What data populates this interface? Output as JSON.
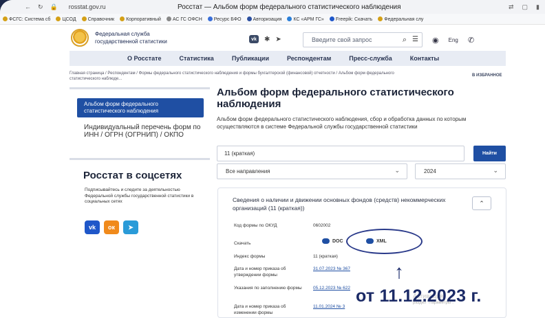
{
  "browser": {
    "url": "rosstat.gov.ru",
    "title": "Росстат — Альбом форм федерального статистического наблюдения",
    "bookmarks": [
      "ФСГС: Система сб",
      "ЦСОД",
      "Справочник",
      "Корпоративный",
      "АС ГС ОФСН",
      "Ресурс БФО",
      "Авторизация",
      "КС «АРМ ГС»",
      "Freepik: Скачать",
      "Федеральная слу"
    ]
  },
  "header": {
    "org_name": "Федеральная служба государственной статистики",
    "search_placeholder": "Введите свой запрос",
    "lang": "Eng"
  },
  "nav": [
    "О Росстате",
    "Статистика",
    "Публикации",
    "Респондентам",
    "Пресс-служба",
    "Контакты"
  ],
  "breadcrumbs": "Главная страница / Респондентам / Формы федерального статистического наблюдения и формы бухгалтерской (финансовой) отчетности / Альбом форм федерального статистического наблюде...",
  "favorite": "В ИЗБРАННОЕ",
  "sidebar": {
    "active_item": "Альбом форм федерального статистического наблюдения",
    "item": "Индивидуальный перечень форм по ИНН / ОГРН (ОГРНИП) / ОКПО",
    "social_title": "Росстат в соцсетях",
    "social_text": "Подписывайтесь и следите за деятельностью Федеральной службы государственной статистики в социальных сетях"
  },
  "main": {
    "title": "Альбом форм федерального статистического наблюдения",
    "lead": "Альбом форм федерального статистического наблюдения, сбор и обработка данных по которым осуществляются в системе Федеральной службы государственной статистики",
    "filter_value": "11 (краткая)",
    "find_button": "Найти",
    "direction_select": "Все направления",
    "year_select": "2024"
  },
  "card": {
    "title": "Сведения о наличии и движении основных фондов (средств) некоммерческих организаций (11 (краткая))",
    "rows": [
      {
        "label": "Код формы по ОКУД",
        "value": "0602002"
      },
      {
        "label": "Скачать",
        "value": ""
      },
      {
        "label": "Индекс формы",
        "value": "11 (краткая)"
      },
      {
        "label": "Дата и номер приказа об утверждении формы",
        "value": "31.07.2023 № 367"
      },
      {
        "label": "Указания по заполнению формы",
        "value": "05.12.2023 № 622"
      },
      {
        "label": "Дата и номер приказа об изменении формы",
        "value": "11.01.2024 № 3"
      }
    ],
    "download_doc": "DOC",
    "download_xml": "XML"
  },
  "watermark": {
    "title": "Активация",
    "text": "раздел \"Параметры\"."
  },
  "annotation": "от 11.12.2023 г."
}
